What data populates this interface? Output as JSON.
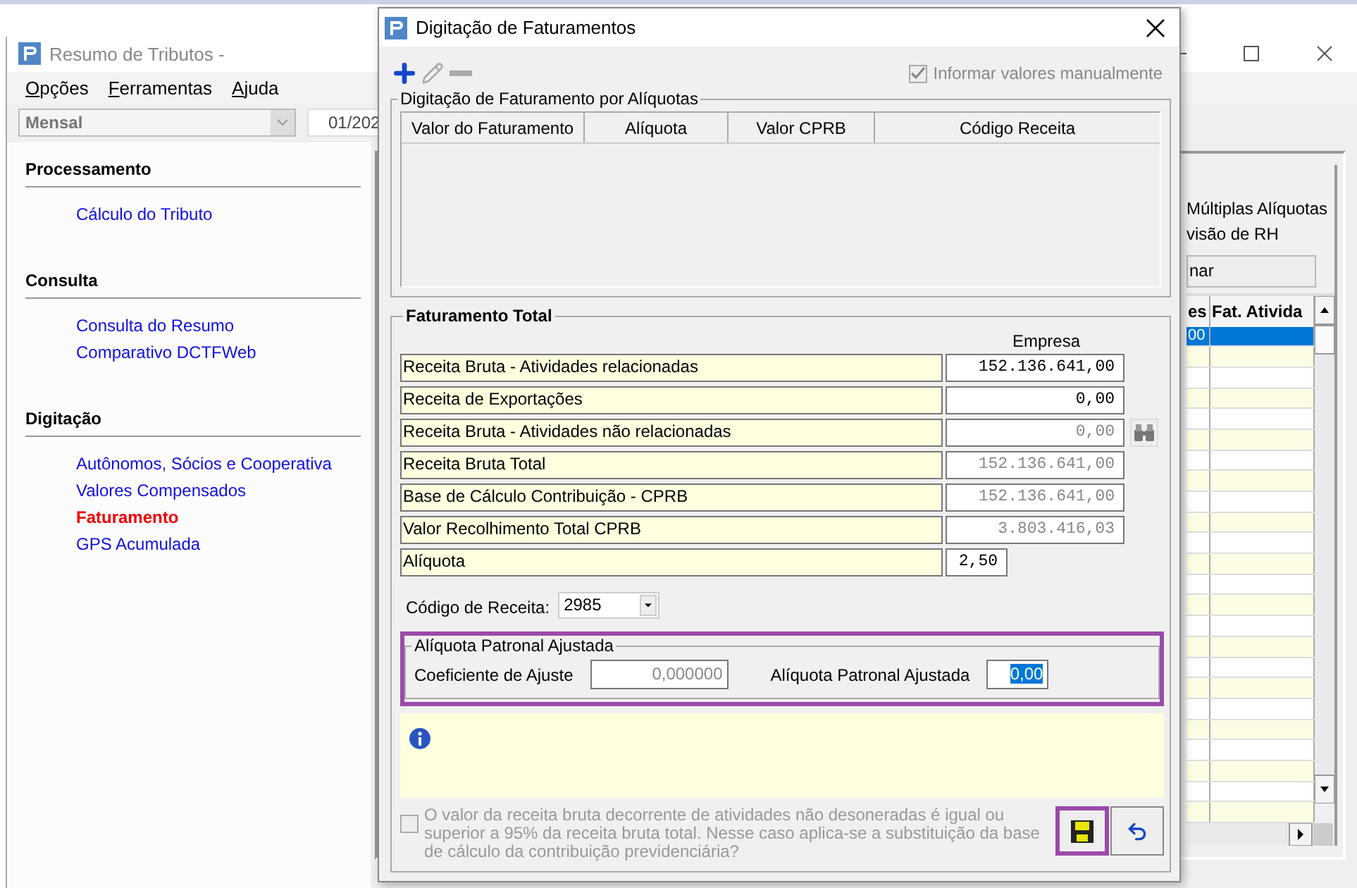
{
  "main_window": {
    "title": "Resumo de Tributos -",
    "menu": [
      {
        "label": "Opções"
      },
      {
        "label": "Ferramentas"
      },
      {
        "label": "Ajuda"
      }
    ],
    "period_select": {
      "value": "Mensal",
      "disabled": true
    },
    "date_field": {
      "value": "01/202"
    },
    "sidebar": [
      {
        "title": "Processamento",
        "items": [
          {
            "label": "Cálculo do Tributo",
            "selected": false
          }
        ]
      },
      {
        "title": "Consulta",
        "items": [
          {
            "label": "Consulta do Resumo",
            "selected": false
          },
          {
            "label": "Comparativo DCTFWeb",
            "selected": false
          }
        ]
      },
      {
        "title": "Digitação",
        "items": [
          {
            "label": "Autônomos, Sócios e Cooperativa",
            "selected": false
          },
          {
            "label": "Valores Compensados",
            "selected": false
          },
          {
            "label": "Faturamento",
            "selected": true
          },
          {
            "label": "GPS Acumulada",
            "selected": false
          }
        ]
      }
    ],
    "options": [
      "Múltiplas Alíquotas",
      "visão de RH"
    ],
    "button": "nar",
    "grid": {
      "columns": [
        "es",
        "Fat. Ativida"
      ],
      "rows": [
        {
          "column_1": "00",
          "selected": true
        }
      ]
    }
  },
  "dialog": {
    "title": "Digitação de Faturamentos",
    "toolbar": [
      {
        "kind": "add",
        "disabled": false
      },
      {
        "kind": "edit",
        "disabled": true
      },
      {
        "kind": "remove",
        "disabled": true
      }
    ],
    "manual_checkbox": {
      "label": "Informar valores manualmente",
      "checked": true,
      "disabled": true
    },
    "rates_group": {
      "title": "Digitação de Faturamento por Alíquotas",
      "columns": [
        "Valor do Faturamento",
        "Alíquota",
        "Valor CPRB",
        "Código Receita"
      ]
    },
    "total_group": {
      "title": "Faturamento Total",
      "column": "Empresa",
      "rows": [
        {
          "label": "Receita Bruta - Atividades relacionadas",
          "value": "152.136.641,00",
          "kind": "wide",
          "disabled": false,
          "lookup": false
        },
        {
          "label": "Receita de Exportações",
          "value": "0,00",
          "kind": "wide",
          "disabled": false,
          "lookup": false
        },
        {
          "label": "Receita Bruta - Atividades não relacionadas",
          "value": "0,00",
          "kind": "wide",
          "disabled": true,
          "lookup": true
        },
        {
          "label": "Receita Bruta Total",
          "value": "152.136.641,00",
          "kind": "wide",
          "disabled": true,
          "lookup": false
        },
        {
          "label": "Base de Cálculo Contribuição - CPRB",
          "value": "152.136.641,00",
          "kind": "wide",
          "disabled": true,
          "lookup": false
        },
        {
          "label": "Valor Recolhimento Total CPRB",
          "value": "3.803.416,03",
          "kind": "wide",
          "disabled": true,
          "lookup": false
        },
        {
          "label": "Alíquota",
          "value": "2,50",
          "kind": "short",
          "disabled": false,
          "lookup": false
        }
      ],
      "code": {
        "label": "Código de Receita:",
        "value": "2985"
      }
    },
    "adjusted_group": {
      "title": "Alíquota Patronal Ajustada",
      "highlighted": true,
      "fields": [
        {
          "label": "Coeficiente de Ajuste",
          "value": "0,000000",
          "disabled": true,
          "text_selected": false
        },
        {
          "label": "Alíquota Patronal Ajustada",
          "value": "0,00",
          "disabled": false,
          "text_selected": true
        }
      ]
    },
    "footer_checkbox": {
      "label": "O valor da receita bruta decorrente de atividades não desoneradas é igual ou superior a 95% da receita bruta total. Nesse caso aplica-se a substituição da base de cálculo da contribuição previdenciária?",
      "checked": false,
      "disabled": true
    },
    "buttons": [
      {
        "kind": "save",
        "highlighted": true
      },
      {
        "kind": "undo",
        "highlighted": false
      }
    ]
  }
}
